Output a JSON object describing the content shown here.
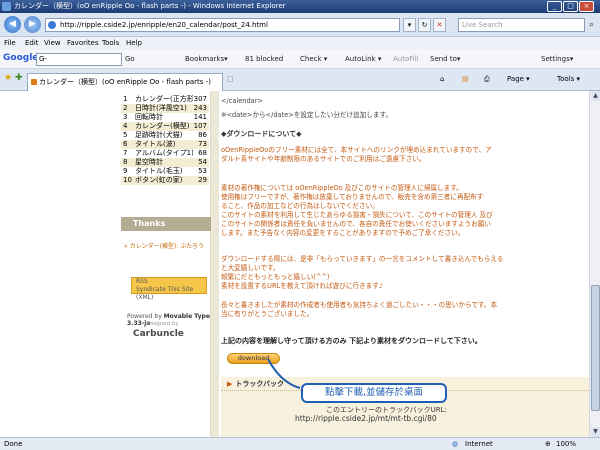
{
  "window": {
    "title": "カレンダー（横型）(oO enRipple Oo - flash parts -) - Windows Internet Explorer",
    "min": "_",
    "max": "□",
    "close": "×"
  },
  "address": {
    "url": "http://ripple.cside2.jp/enripple/en20_calendar/post_24.html",
    "search_placeholder": "Live Search"
  },
  "menu": [
    "File",
    "Edit",
    "View",
    "Favorites",
    "Tools",
    "Help"
  ],
  "google_toolbar": {
    "logo": "Google",
    "search_value": "G-",
    "go": "Go",
    "bookmarks": "Bookmarks▾",
    "blocked": "81 blocked",
    "check": "Check ▾",
    "autolink": "AutoLink ▾",
    "autofill": "AutoFill",
    "sendto": "Send to▾",
    "settings": "Settings▾"
  },
  "tab": {
    "title": "カレンダー（横型）(oO enRipple Oo - flash parts -)",
    "page": "Page ▾",
    "tools": "Tools ▾"
  },
  "sidebar": {
    "categories": [
      {
        "n": "1",
        "name": "カレンダー(正方形)",
        "count": "307"
      },
      {
        "n": "2",
        "name": "日時計(洋風空1)",
        "count": "243"
      },
      {
        "n": "3",
        "name": "回転時計",
        "count": "141"
      },
      {
        "n": "4",
        "name": "カレンダー(横型)",
        "count": "107"
      },
      {
        "n": "5",
        "name": "足跡時計(犬猫)",
        "count": "86"
      },
      {
        "n": "6",
        "name": "タイトル(波)",
        "count": "73"
      },
      {
        "n": "7",
        "name": "アルバム(タイプ1)",
        "count": "68"
      },
      {
        "n": "8",
        "name": "星空時計",
        "count": "54"
      },
      {
        "n": "9",
        "name": "タイトル(毛玉)",
        "count": "53"
      },
      {
        "n": "10",
        "name": "ボタン(虹の家)",
        "count": "29"
      }
    ],
    "thanks_title": "Thanks Comments",
    "thanks_item": "» カレンダー(横型): ぶたろう",
    "rss_line1": "RSS",
    "rss_line2": "Syndicate This Site (XML)",
    "powered_prefix": "Powered by ",
    "powered_product": "Movable Type 3.33-ja",
    "designed_by": "designed by",
    "carbuncle": "Carbuncle"
  },
  "main": {
    "line_calendar": "</calendar>",
    "line_date": "※<date>から</date>を設定したい分だけ追加します。",
    "dl_heading": "◆ダウンロードについて◆",
    "p1": [
      "oOenRippleOoのフリー素材には全て、本サイトへのリンクが埋め込まれていますので、ア",
      "ダルト系サイトや年齢制限のあるサイトでのご利用はご遠慮下さい。"
    ],
    "p2": [
      "素材の著作権については oOenRippleOo 及びこのサイトの管理人に帰属します。",
      "使用権はフリーですが、著作権は放棄しておりませんので、販売を含め第三者に再配布す",
      "ること、作品の加工などの行為はしないでください。",
      "このサイトの素材を利用して生じたあらゆる損害・損失について、このサイトの管理人 及び",
      "このサイトの関係者は責任を負いませんので、各自の責任でお使いくださいますようお願い",
      "します。また予告なく内容の変更をすることがありますので予めご了承ください。"
    ],
    "p3": [
      "ダウンロードする際には、是非「もらっていきます」の一言をコメントして書き込んでもらえる",
      "と大変嬉しいです。",
      "頻繁にだともっともっと嬉しい(^^)",
      "素材を設置するURLを教えて頂ければ遊びに行きます♪"
    ],
    "p4": [
      "長々と書きましたが素材の作成者も使用者も気持ちよく過ごしたい・・・の思いからです。本",
      "当に有りがとうございました。"
    ],
    "notice": "上記の内容を理解し守って頂ける方のみ 下記より素材をダウンロードして下さい。",
    "download_btn": "download",
    "trackback_title": "トラックバック",
    "trackback_label": "このエントリーのトラックバックURL:",
    "trackback_url": "http://ripple.cside2.jp/mt/mt-tb.cgi/80"
  },
  "callout": "點擊下載,並儲存於桌面",
  "status": {
    "left": "Done",
    "zone": "Internet",
    "zoom": "100%"
  },
  "colors": {
    "accent_orange": "#c55a11",
    "callout_blue": "#1f5fb3",
    "tan": "#b5ac94"
  }
}
